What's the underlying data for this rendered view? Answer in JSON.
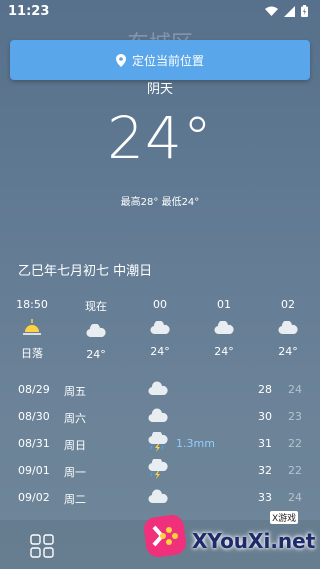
{
  "status": {
    "time": "11:23"
  },
  "header": {
    "city": "东城区",
    "condition": "阴天"
  },
  "locate_button": {
    "label": "定位当前位置"
  },
  "current": {
    "temperature": "24°",
    "high_low": "最高28° 最低24°"
  },
  "lunar_date": "乙巳年七月初七 中潮日",
  "hourly": [
    {
      "time": "18:50",
      "icon": "sunset-icon",
      "temp": "日落"
    },
    {
      "time": "现在",
      "icon": "cloudy-icon",
      "temp": "24°"
    },
    {
      "time": "00",
      "icon": "cloudy-icon",
      "temp": "24°"
    },
    {
      "time": "01",
      "icon": "cloudy-icon",
      "temp": "24°"
    },
    {
      "time": "02",
      "icon": "cloudy-icon",
      "temp": "24°"
    }
  ],
  "daily": [
    {
      "date": "08/29",
      "weekday": "周五",
      "icon": "cloudy-icon",
      "precip": "",
      "high": "28",
      "low": "24"
    },
    {
      "date": "08/30",
      "weekday": "周六",
      "icon": "cloudy-icon",
      "precip": "",
      "high": "30",
      "low": "23"
    },
    {
      "date": "08/31",
      "weekday": "周日",
      "icon": "thunder-rain-icon",
      "precip": "1.3mm",
      "high": "31",
      "low": "22"
    },
    {
      "date": "09/01",
      "weekday": "周一",
      "icon": "thunder-icon",
      "precip": "",
      "high": "32",
      "low": "22"
    },
    {
      "date": "09/02",
      "weekday": "周二",
      "icon": "cloudy-icon",
      "precip": "",
      "high": "33",
      "low": "24"
    }
  ],
  "watermark": {
    "text": "XYouXi.net",
    "sub": "X游戏"
  },
  "colors": {
    "button": "#5aa6ea",
    "precip": "#8fd0ff",
    "low_temp": "#b5c3cf"
  }
}
